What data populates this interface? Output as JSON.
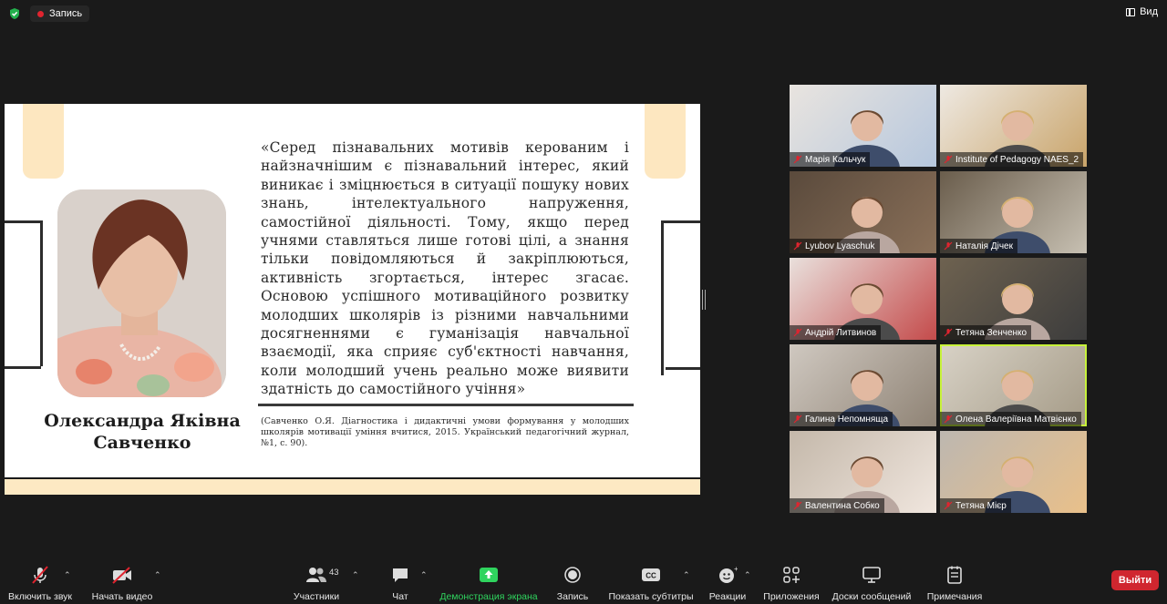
{
  "top_bar": {
    "record_label": "Запись",
    "view_label": "Вид"
  },
  "slide": {
    "quote": "«Серед пізнавальних мотивів керованим і найзначнішим є пізнавальний інтерес, який виникає і зміцнюється в ситуації пошуку нових знань, інтелектуального напруження, самостійної діяльності. Тому, якщо перед учнями ставляться лише готові цілі, а знання тільки повідомляються й закріплюються, активність згортається, інтерес згасає. Основою успішного мотиваційного розвитку молодших школярів із різними навчальними досягненнями є гуманізація навчальної взаємодії, яка сприяє суб'єктності навчання, коли молодший учень реально може виявити здатність до самостійного учіння»",
    "author_line1": "Олександра Яківна",
    "author_line2": "Савченко",
    "citation": "(Савченко О.Я. Діагностика і дидактичні умови формування у молодших школярів мотивації уміння вчитися, 2015. Український педагогічний журнал, №1, с. 90)."
  },
  "participants": [
    {
      "name": "Марія Кальчук"
    },
    {
      "name": "Institute of Pedagogy NAES_2"
    },
    {
      "name": "Lyubov Lyaschuk"
    },
    {
      "name": "Наталія Дічек"
    },
    {
      "name": "Андрій Литвинов"
    },
    {
      "name": "Тетяна Зенченко"
    },
    {
      "name": "Галина Непомняща"
    },
    {
      "name": "Олена Валеріївна Матвієнко"
    },
    {
      "name": "Валентина Собко"
    },
    {
      "name": "Тетяна Мієр"
    }
  ],
  "toolbar": {
    "mute_label": "Включить звук",
    "video_label": "Начать видео",
    "participants_label": "Участники",
    "participants_count": "43",
    "chat_label": "Чат",
    "share_label": "Демонстрация экрана",
    "record_label": "Запись",
    "captions_label": "Показать субтитры",
    "captions_icon_text": "CC",
    "reactions_label": "Реакции",
    "apps_label": "Приложения",
    "whiteboards_label": "Доски сообщений",
    "notes_label": "Примечания",
    "end_label": "Выйти"
  },
  "colors": {
    "accent_green": "#2fd45e",
    "end_red": "#d0262f",
    "active_speaker": "#c7f23a",
    "muted_red": "#e0242f",
    "slide_cream": "#fde7c0"
  },
  "icons": [
    "shield-icon",
    "record-dot-icon",
    "view-icon",
    "mic-muted-icon",
    "camera-off-icon",
    "participants-icon",
    "chat-icon",
    "share-screen-icon",
    "record-icon",
    "captions-icon",
    "reactions-icon",
    "apps-icon",
    "whiteboard-icon",
    "notes-icon"
  ]
}
